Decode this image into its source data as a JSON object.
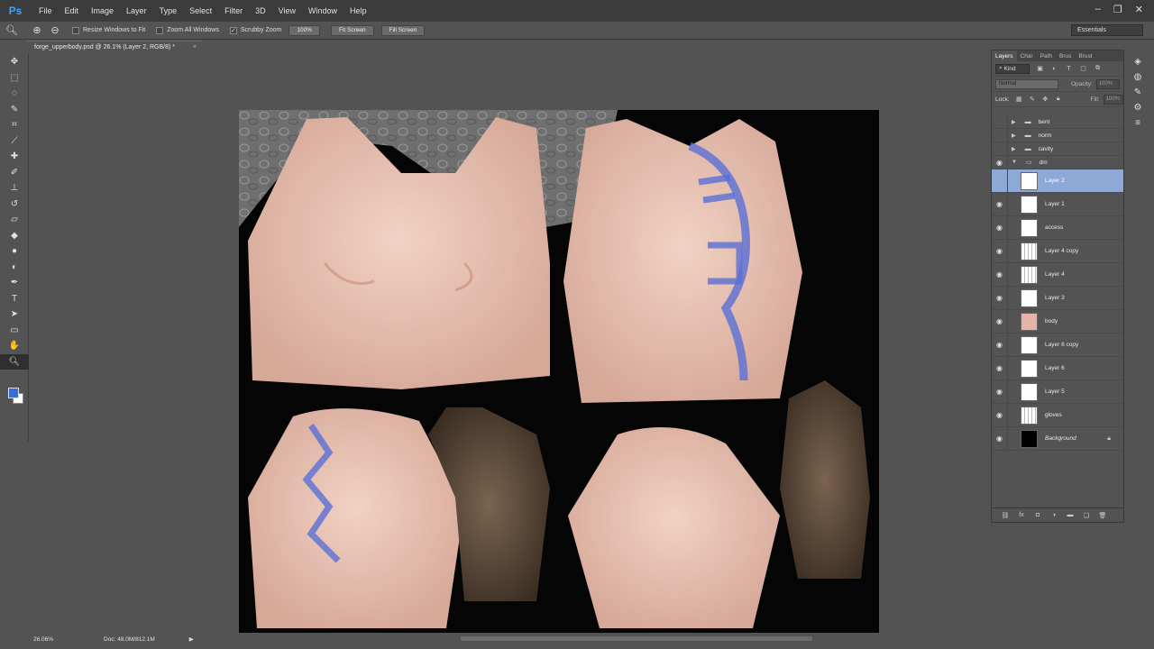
{
  "app": {
    "logo": "Ps"
  },
  "menu": [
    "File",
    "Edit",
    "Image",
    "Layer",
    "Type",
    "Select",
    "Filter",
    "3D",
    "View",
    "Window",
    "Help"
  ],
  "options": {
    "resize_windows": "Resize Windows to Fit",
    "zoom_all": "Zoom All Windows",
    "scrubby": "Scrubby Zoom",
    "btn_100": "100%",
    "btn_fit": "Fit Screen",
    "btn_fill": "Fill Screen",
    "workspace": "Essentials"
  },
  "document": {
    "tab_title": "forge_upperbody.psd @ 26.1% (Layer 2, RGB/8) *",
    "zoom": "26.06%",
    "doc_size": "Doc: 48.0M/812.1M"
  },
  "colors": {
    "foreground": "#3b6cd1",
    "background": "#ffffff",
    "selected_layer": "#8fa9d6"
  },
  "panel": {
    "tabs": [
      "Layers",
      "Char",
      "Path",
      "Brus",
      "Brust"
    ],
    "kind": "Kind",
    "blend": "Normal",
    "opacity_label": "Opacity:",
    "opacity_value": "100%",
    "lock_label": "Lock:",
    "fill_label": "Fill:",
    "fill_value": "100%",
    "groups": [
      "bent",
      "norm",
      "cavity",
      "dm"
    ],
    "layers": [
      "Layer 2",
      "Layer 1",
      "access",
      "Layer 4 copy",
      "Layer 4",
      "Layer 3",
      "body",
      "Layer 6 copy",
      "Layer 6",
      "Layer 5",
      "gloves",
      "Background"
    ]
  }
}
